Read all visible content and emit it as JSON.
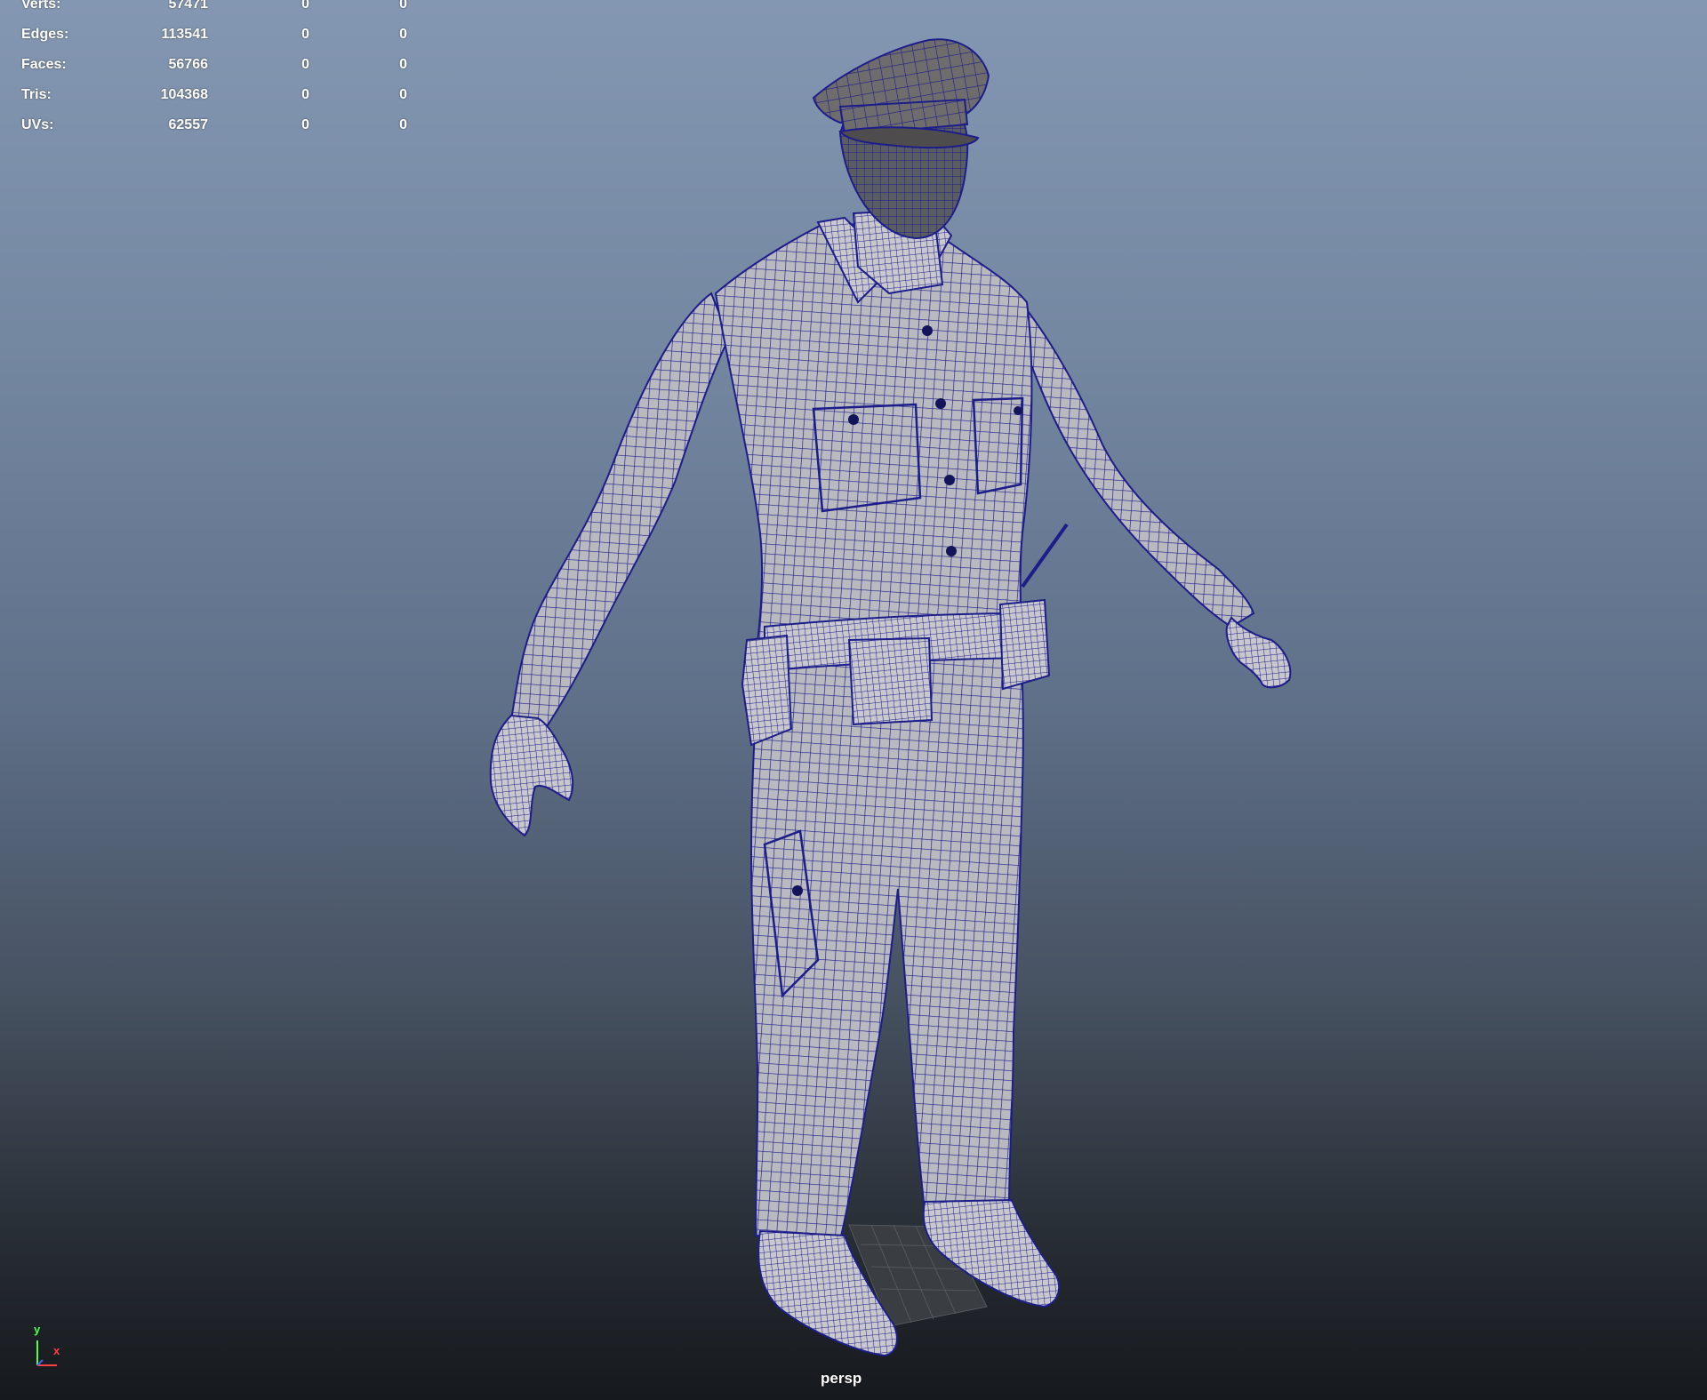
{
  "stats": [
    {
      "label": "Verts:",
      "v1": "57471",
      "v2": "0",
      "v3": "0"
    },
    {
      "label": "Edges:",
      "v1": "113541",
      "v2": "0",
      "v3": "0"
    },
    {
      "label": "Faces:",
      "v1": "56766",
      "v2": "0",
      "v3": "0"
    },
    {
      "label": "Tris:",
      "v1": "104368",
      "v2": "0",
      "v3": "0"
    },
    {
      "label": "UVs:",
      "v1": "62557",
      "v2": "0",
      "v3": "0"
    }
  ],
  "camera": "persp",
  "axis": {
    "y": "y",
    "x": "x"
  },
  "colors": {
    "wire": "#1a1a8c",
    "mesh_fill": "#b8b8be",
    "cap_fill": "#6a6a6e",
    "skin_fill": "#55585f"
  },
  "model": "police-officer-wireframe-mesh"
}
